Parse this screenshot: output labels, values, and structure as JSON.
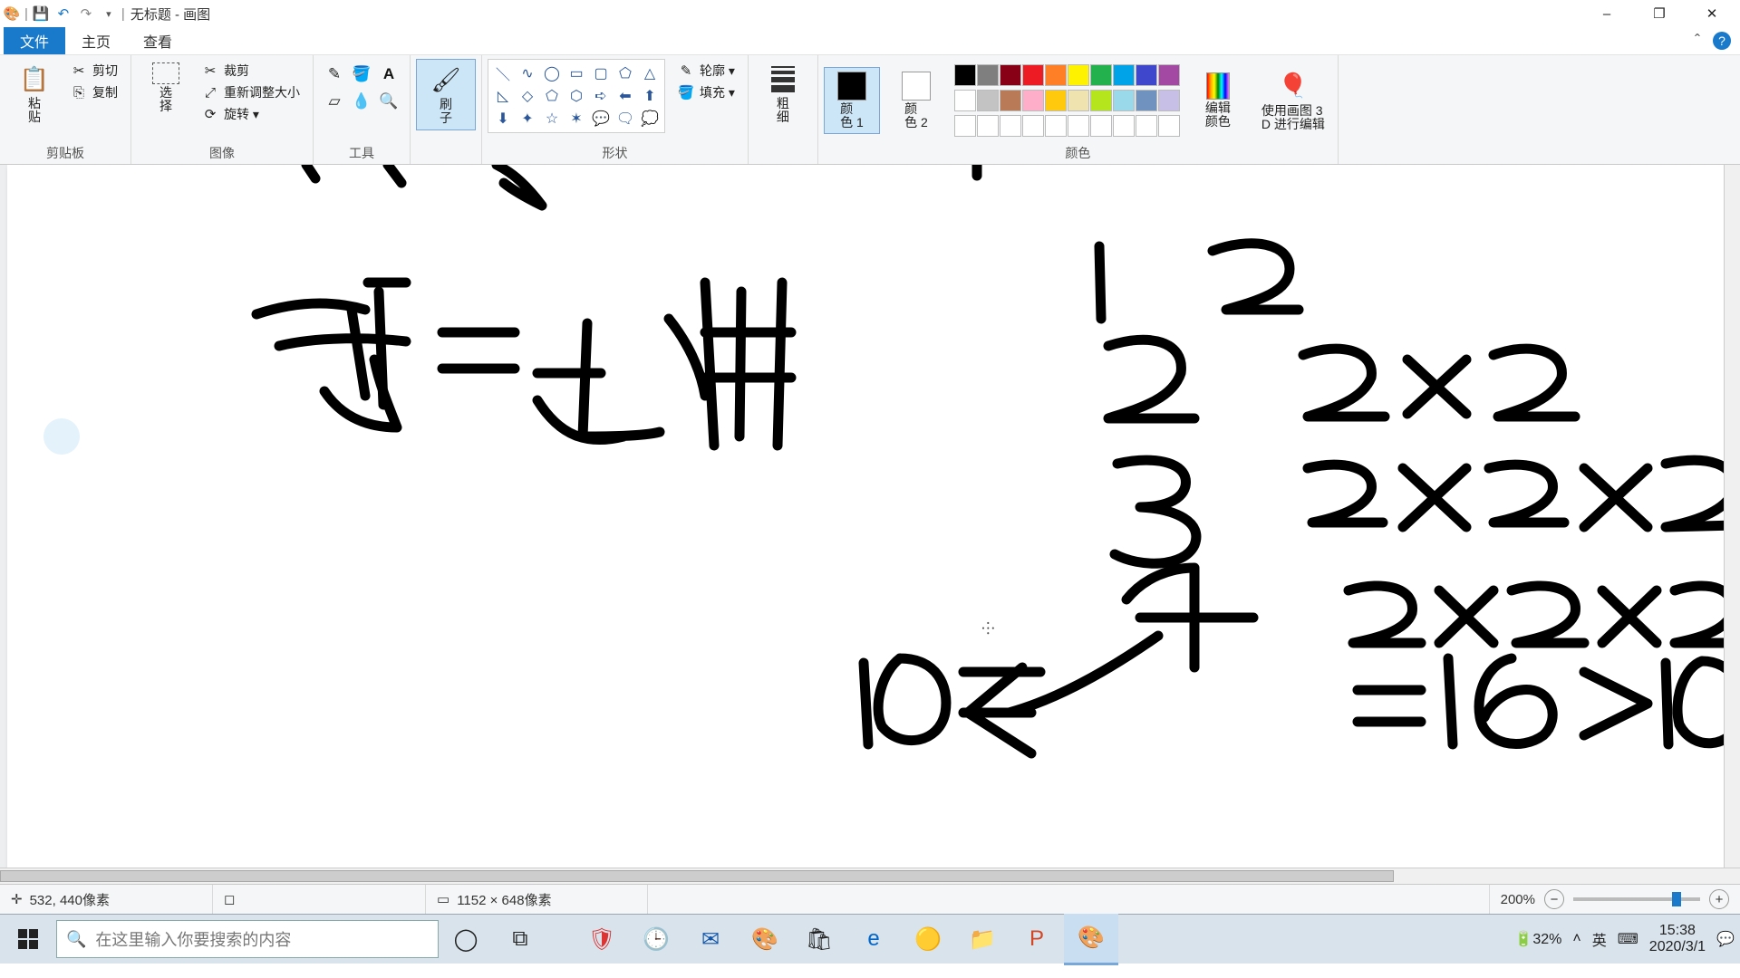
{
  "window": {
    "title": "无标题 - 画图",
    "min": "–",
    "max": "❐",
    "close": "✕"
  },
  "qat": {
    "save": "💾",
    "undo": "↶",
    "redo": "↷",
    "dd": "▾"
  },
  "tabs": {
    "file": "文件",
    "home": "主页",
    "view": "查看"
  },
  "ribbon_help": {
    "collapse": "ˆ",
    "help": "?"
  },
  "clipboard": {
    "paste": "粘\n贴",
    "cut": "剪切",
    "copy": "复制",
    "label": "剪贴板"
  },
  "image": {
    "select": "选\n择",
    "crop": "裁剪",
    "resize": "重新调整大小",
    "rotate": "旋转 ▾",
    "label": "图像"
  },
  "tools": {
    "label": "工具"
  },
  "brush": {
    "label": "刷\n子"
  },
  "shapes": {
    "outline": "轮廓 ▾",
    "fill": "填充 ▾",
    "label": "形状"
  },
  "size": {
    "label": "粗\n细"
  },
  "color1": {
    "label": "颜\n色 1"
  },
  "color2": {
    "label": "颜\n色 2"
  },
  "editcolor": "编辑\n颜色",
  "paint3d": "使用画图 3\nD 进行编辑",
  "colors_label": "颜色",
  "status": {
    "coords": "532, 440像素",
    "size": "1152 × 648像素",
    "zoom": "200%"
  },
  "taskbar": {
    "search_placeholder": "在这里输入你要搜索的内容",
    "battery": "32%",
    "ime1": "英",
    "clock_time": "15:38",
    "clock_date": "2020/3/1"
  },
  "palette_top": [
    "#000000",
    "#7f7f7f",
    "#880015",
    "#ed1c24",
    "#ff7f27",
    "#fff200",
    "#22b14c",
    "#00a2e8",
    "#3f48cc",
    "#a349a4"
  ],
  "palette_bot": [
    "#ffffff",
    "#c3c3c3",
    "#b97a57",
    "#ffaec9",
    "#ffc90e",
    "#efe4b0",
    "#b5e61d",
    "#99d9ea",
    "#7092be",
    "#c8bfe7"
  ]
}
